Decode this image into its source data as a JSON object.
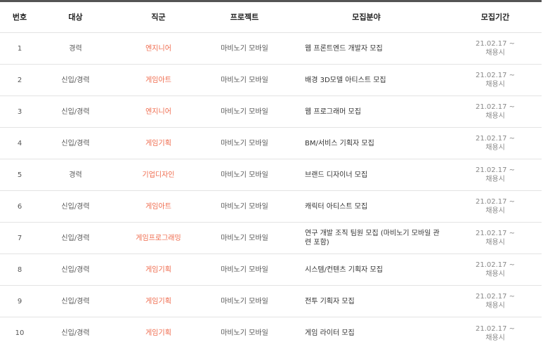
{
  "headers": {
    "num": "번호",
    "target": "대상",
    "job": "직군",
    "project": "프로젝트",
    "field": "모집분야",
    "period": "모집기간"
  },
  "rows": [
    {
      "num": "1",
      "target": "경력",
      "job": "엔지니어",
      "project": "마비노기 모바일",
      "field": "웹 프론트엔드 개발자 모집",
      "period_date": "21.02.17 ~",
      "period_note": "채용시"
    },
    {
      "num": "2",
      "target": "신입/경력",
      "job": "게임아트",
      "project": "마비노기 모바일",
      "field": "배경 3D모델 아티스트 모집",
      "period_date": "21.02.17 ~",
      "period_note": "채용시"
    },
    {
      "num": "3",
      "target": "신입/경력",
      "job": "엔지니어",
      "project": "마비노기 모바일",
      "field": "웹 프로그래머 모집",
      "period_date": "21.02.17 ~",
      "period_note": "채용시"
    },
    {
      "num": "4",
      "target": "신입/경력",
      "job": "게임기획",
      "project": "마비노기 모바일",
      "field": "BM/서비스 기획자 모집",
      "period_date": "21.02.17 ~",
      "period_note": "채용시"
    },
    {
      "num": "5",
      "target": "경력",
      "job": "기업디자인",
      "project": "마비노기 모바일",
      "field": "브랜드 디자이너 모집",
      "period_date": "21.02.17 ~",
      "period_note": "채용시"
    },
    {
      "num": "6",
      "target": "신입/경력",
      "job": "게임아트",
      "project": "마비노기 모바일",
      "field": "캐릭터 아티스트 모집",
      "period_date": "21.02.17 ~",
      "period_note": "채용시"
    },
    {
      "num": "7",
      "target": "신입/경력",
      "job": "게임프로그래밍",
      "project": "마비노기 모바일",
      "field": "연구 개발 조직 팀원 모집 (마비노기 모바일 관련 포함)",
      "period_date": "21.02.17 ~",
      "period_note": "채용시"
    },
    {
      "num": "8",
      "target": "신입/경력",
      "job": "게임기획",
      "project": "마비노기 모바일",
      "field": "시스템/컨텐츠 기획자 모집",
      "period_date": "21.02.17 ~",
      "period_note": "채용시"
    },
    {
      "num": "9",
      "target": "신입/경력",
      "job": "게임기획",
      "project": "마비노기 모바일",
      "field": "전투 기획자 모집",
      "period_date": "21.02.17 ~",
      "period_note": "채용시"
    },
    {
      "num": "10",
      "target": "신입/경력",
      "job": "게임기획",
      "project": "마비노기 모바일",
      "field": "게임 라이터 모집",
      "period_date": "21.02.17 ~",
      "period_note": "채용시"
    }
  ]
}
